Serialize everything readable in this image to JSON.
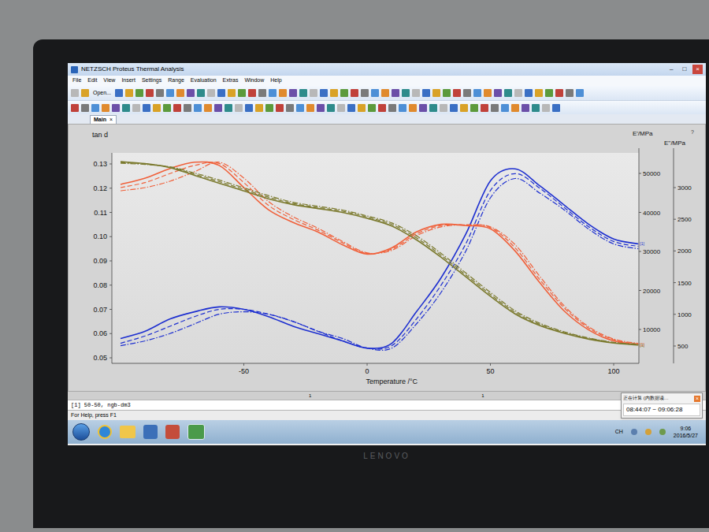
{
  "window": {
    "title": "NETZSCH Proteus Thermal Analysis",
    "controls": [
      "–",
      "□",
      "×"
    ]
  },
  "menu": [
    "File",
    "Edit",
    "View",
    "Insert",
    "Settings",
    "Range",
    "Evaluation",
    "Extras",
    "Window",
    "Help"
  ],
  "toolbar": {
    "open_button": "Open..."
  },
  "tabs": [
    {
      "label": "Main",
      "selected": true,
      "close": "×"
    }
  ],
  "chart": {
    "help": "?",
    "left_axis": {
      "title": "tan d",
      "ticks": [
        "0.05",
        "0.06",
        "0.07",
        "0.08",
        "0.09",
        "0.10",
        "0.11",
        "0.12",
        "0.13"
      ]
    },
    "right_axes": [
      {
        "id": "E1",
        "title": "E'/MPa",
        "ticks": [
          "10000",
          "20000",
          "30000",
          "40000",
          "50000"
        ]
      },
      {
        "id": "E2",
        "title": "E''/MPa",
        "ticks": [
          "500",
          "1000",
          "1500",
          "2000",
          "2500",
          "3000"
        ]
      }
    ],
    "x_axis": {
      "title": "Temperature /°C",
      "ticks": [
        "-50",
        "0",
        "50",
        "100"
      ]
    },
    "temperatures": [
      -100,
      -90,
      -80,
      -70,
      -60,
      -50,
      -40,
      -30,
      -20,
      -10,
      0,
      10,
      20,
      30,
      40,
      50,
      60,
      70,
      80,
      90,
      100,
      110
    ],
    "series": [
      {
        "name": "tan d",
        "axis": "tan",
        "color": "#1d2fd0",
        "end_label": "[1]",
        "runs": [
          [
            0.058,
            0.061,
            0.066,
            0.069,
            0.071,
            0.07,
            0.067,
            0.063,
            0.06,
            0.057,
            0.054,
            0.056,
            0.069,
            0.083,
            0.101,
            0.123,
            0.128,
            0.121,
            0.113,
            0.105,
            0.099,
            0.097
          ],
          [
            0.056,
            0.059,
            0.063,
            0.067,
            0.07,
            0.07,
            0.068,
            0.065,
            0.061,
            0.057,
            0.054,
            0.055,
            0.066,
            0.08,
            0.097,
            0.119,
            0.126,
            0.12,
            0.112,
            0.104,
            0.098,
            0.096
          ],
          [
            0.055,
            0.057,
            0.06,
            0.064,
            0.068,
            0.069,
            0.068,
            0.065,
            0.061,
            0.058,
            0.054,
            0.054,
            0.064,
            0.077,
            0.094,
            0.116,
            0.124,
            0.118,
            0.111,
            0.103,
            0.097,
            0.095
          ]
        ]
      },
      {
        "name": "E''",
        "axis": "E2",
        "color": "#f0603a",
        "end_label": "[1]",
        "runs": [
          [
            3050,
            3150,
            3300,
            3400,
            3350,
            3000,
            2650,
            2450,
            2300,
            2100,
            1950,
            2050,
            2300,
            2420,
            2400,
            2350,
            2000,
            1500,
            1050,
            750,
            580,
            520
          ],
          [
            3000,
            3080,
            3220,
            3350,
            3380,
            3080,
            2720,
            2500,
            2330,
            2130,
            1960,
            2030,
            2270,
            2400,
            2410,
            2370,
            2050,
            1550,
            1100,
            780,
            600,
            530
          ],
          [
            2950,
            3000,
            3100,
            3250,
            3400,
            3150,
            2780,
            2540,
            2360,
            2150,
            1970,
            2010,
            2240,
            2380,
            2410,
            2380,
            2100,
            1600,
            1130,
            800,
            610,
            540
          ]
        ]
      },
      {
        "name": "E'",
        "axis": "E1",
        "color": "#7b7a2e",
        "end_label": "[1]",
        "runs": [
          [
            53000,
            52500,
            51500,
            49500,
            47500,
            45500,
            43500,
            42000,
            41000,
            40000,
            38500,
            36500,
            33000,
            28500,
            23500,
            18500,
            14000,
            11000,
            9000,
            7500,
            6500,
            6000
          ],
          [
            52800,
            52400,
            51600,
            49800,
            47900,
            45900,
            43900,
            42300,
            41300,
            40300,
            38800,
            36900,
            33500,
            29000,
            24000,
            19000,
            14400,
            11300,
            9200,
            7700,
            6600,
            6100
          ],
          [
            52600,
            52300,
            51700,
            50100,
            48300,
            46300,
            44300,
            42600,
            41600,
            40600,
            39100,
            37300,
            34000,
            29500,
            24500,
            19500,
            14800,
            11600,
            9400,
            7800,
            6700,
            6200
          ]
        ]
      }
    ],
    "cursor_marks": [
      "1",
      "1"
    ]
  },
  "status": {
    "dataset": "[1] 50-50, ngb-dm3",
    "help": "For Help, press F1"
  },
  "notification": {
    "title": "正在计算 (内数据读…",
    "close": "×",
    "range": "08:44:07 ~ 09:06:28"
  },
  "taskbar": {
    "language": "CH",
    "time": "9:06",
    "date": "2016/5/27"
  },
  "monitor": {
    "brand": "LENOVO"
  }
}
